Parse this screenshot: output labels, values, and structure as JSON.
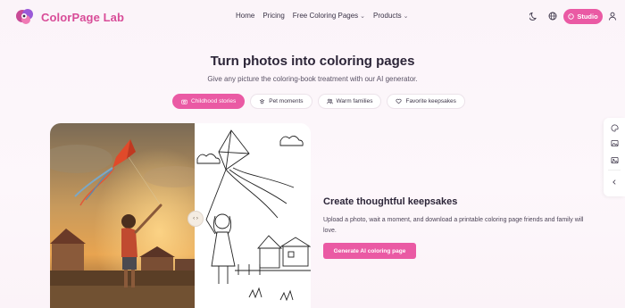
{
  "brand": {
    "name": "ColorPage Lab",
    "color": "#d84c98"
  },
  "nav": {
    "items": [
      {
        "label": "Home",
        "dropdown": false
      },
      {
        "label": "Pricing",
        "dropdown": false
      },
      {
        "label": "Free Coloring Pages",
        "dropdown": true
      },
      {
        "label": "Products",
        "dropdown": true
      }
    ]
  },
  "header_icons": [
    "moon-icon",
    "globe-icon",
    "user-icon"
  ],
  "studio": {
    "label": "Studio",
    "icon": "palette-icon"
  },
  "hero": {
    "title": "Turn photos into coloring pages",
    "subtitle": "Give any picture the coloring-book treatment with our AI generator."
  },
  "tabs": [
    {
      "label": "Childhood stories",
      "active": true,
      "icon": "camera-icon"
    },
    {
      "label": "Pet moments",
      "active": false,
      "icon": "paw-icon"
    },
    {
      "label": "Warm families",
      "active": false,
      "icon": "family-icon"
    },
    {
      "label": "Favorite keepsakes",
      "active": false,
      "icon": "heart-icon"
    }
  ],
  "feature": {
    "title": "Create thoughtful keepsakes",
    "text": "Upload a photo, wait a moment, and download a printable coloring page friends and family will love.",
    "cta": "Generate AI coloring page"
  },
  "compare": {
    "handle_glyph": "‹ ›"
  },
  "dock": [
    "palette-icon",
    "image-icon",
    "image-icon",
    "chevron-left-icon"
  ],
  "colors": {
    "accent": "#ea5aa4",
    "text": "#2c2538"
  }
}
